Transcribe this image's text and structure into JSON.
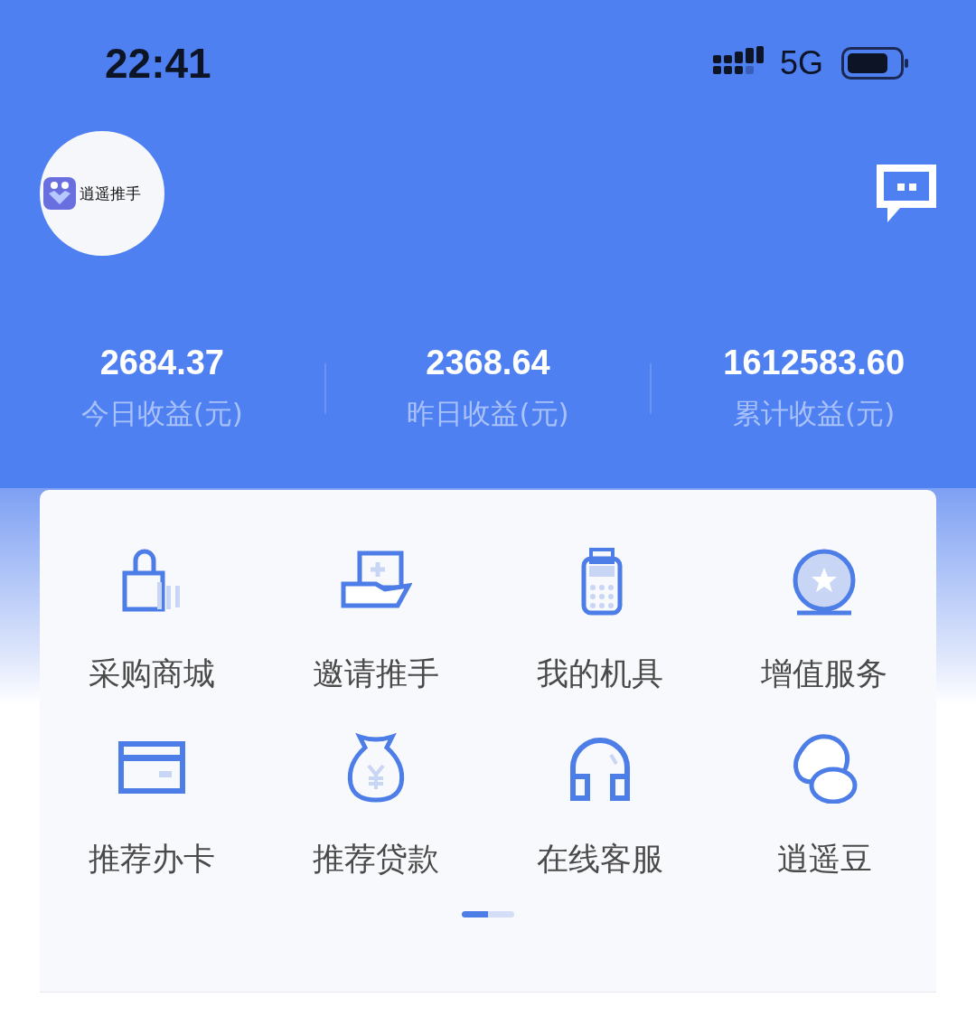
{
  "status_bar": {
    "time": "22:41",
    "network": "5G"
  },
  "header": {
    "logo_text": "逍遥推手"
  },
  "stats": [
    {
      "value": "2684.37",
      "label": "今日收益(元)"
    },
    {
      "value": "2368.64",
      "label": "昨日收益(元)"
    },
    {
      "value": "1612583.60",
      "label": "累计收益(元)"
    }
  ],
  "menu": [
    {
      "label": "采购商城"
    },
    {
      "label": "邀请推手"
    },
    {
      "label": "我的机具"
    },
    {
      "label": "增值服务"
    },
    {
      "label": "推荐办卡"
    },
    {
      "label": "推荐贷款"
    },
    {
      "label": "在线客服"
    },
    {
      "label": "逍遥豆"
    }
  ],
  "pager": [
    {
      "selected": true
    },
    {
      "selected": false
    }
  ]
}
